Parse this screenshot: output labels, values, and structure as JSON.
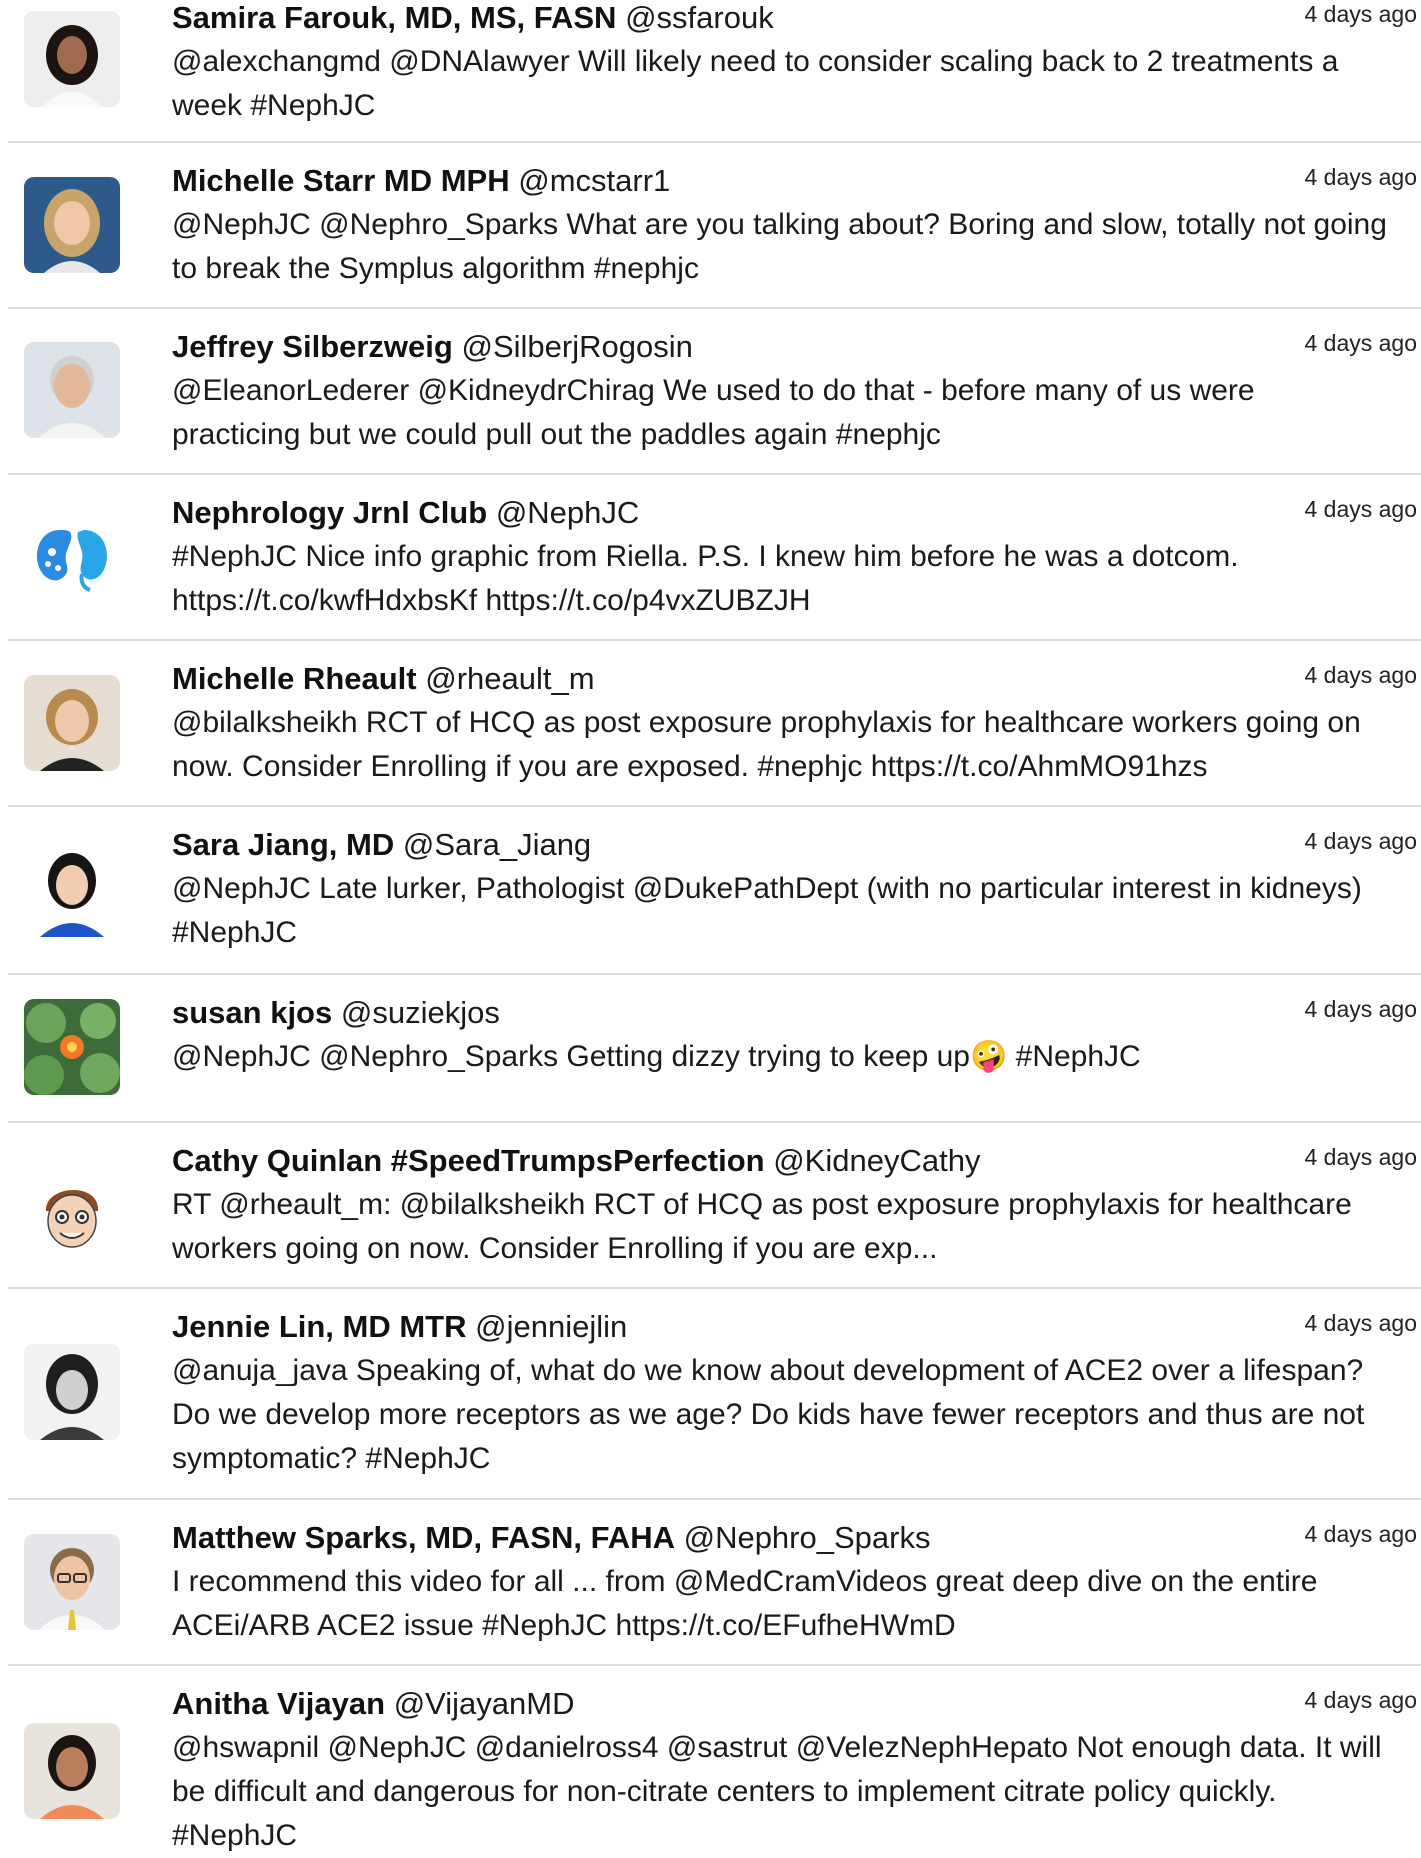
{
  "tweets": [
    {
      "name": "Samira Farouk, MD, MS, FASN",
      "handle": "@ssfarouk",
      "time": "4 days ago",
      "avatar": "woman-dark-hair-avatar",
      "lines": [
        "@alexchangmd @DNAlawyer Will likely need to consider scaling back to 2 treatments a",
        "week #NephJC"
      ]
    },
    {
      "name": "Michelle Starr MD MPH",
      "handle": "@mcstarr1",
      "time": "4 days ago",
      "avatar": "woman-blonde-avatar",
      "lines": [
        "@NephJC @Nephro_Sparks What are you talking about? Boring and slow, totally not going",
        "to break the Symplus algorithm #nephjc"
      ]
    },
    {
      "name": "Jeffrey Silberzweig",
      "handle": "@SilberjRogosin",
      "time": "4 days ago",
      "avatar": "man-grey-hair-avatar",
      "lines": [
        "@EleanorLederer @KidneydrChirag We used to do that - before many of us were",
        "practicing but we could pull out the paddles again #nephjc"
      ]
    },
    {
      "name": "Nephrology Jrnl Club",
      "handle": "@NephJC",
      "time": "4 days ago",
      "avatar": "kidney-logo-avatar",
      "lines": [
        "#NephJC Nice info graphic from Riella. P.S. I knew him before he was a dotcom.",
        "https://t.co/kwfHdxbsKf https://t.co/p4vxZUBZJH"
      ]
    },
    {
      "name": "Michelle Rheault",
      "handle": "@rheault_m",
      "time": "4 days ago",
      "avatar": "woman-short-hair-avatar",
      "lines": [
        "@bilalksheikh RCT of HCQ as post exposure prophylaxis for healthcare workers going on",
        "now. Consider Enrolling if you are exposed. #nephjc https://t.co/AhmMO91hzs"
      ]
    },
    {
      "name": "Sara Jiang, MD",
      "handle": "@Sara_Jiang",
      "time": "4 days ago",
      "avatar": "woman-blue-top-avatar",
      "lines": [
        "@NephJC Late lurker, Pathologist @DukePathDept (with no particular interest in kidneys)",
        "#NephJC"
      ]
    },
    {
      "name": "susan kjos",
      "handle": "@suziekjos",
      "time": "4 days ago",
      "avatar": "lily-pad-flower-avatar",
      "lines": [
        "@NephJC @Nephro_Sparks Getting dizzy trying to keep up🤪  #NephJC"
      ]
    },
    {
      "name": "Cathy Quinlan #SpeedTrumpsPerfection",
      "handle": "@KidneyCathy",
      "time": "4 days ago",
      "avatar": "cartoon-face-avatar",
      "lines": [
        "RT @rheault_m: @bilalksheikh RCT of HCQ as post exposure prophylaxis for healthcare",
        "workers going on now. Consider Enrolling if you are exp..."
      ]
    },
    {
      "name": "Jennie Lin, MD MTR",
      "handle": "@jenniejlin",
      "time": "4 days ago",
      "avatar": "woman-bw-photo-avatar",
      "lines": [
        "@anuja_java Speaking of, what do we know about development of ACE2 over a lifespan?",
        "Do we develop more receptors as we age? Do kids have fewer receptors and thus are not",
        "symptomatic? #NephJC"
      ]
    },
    {
      "name": "Matthew Sparks, MD, FASN, FAHA",
      "handle": "@Nephro_Sparks",
      "time": "4 days ago",
      "avatar": "man-glasses-avatar",
      "lines": [
        "I recommend this video for all ... from @MedCramVideos great deep dive on the entire",
        "ACEi/ARB ACE2 issue #NephJC https://t.co/EFufheHWmD"
      ]
    },
    {
      "name": "Anitha Vijayan",
      "handle": "@VijayanMD",
      "time": "4 days ago",
      "avatar": "woman-orange-top-avatar",
      "lines": [
        "@hswapnil @NephJC @danielross4 @sastrut @VelezNephHepato Not enough data. It will",
        "be difficult and dangerous for non-citrate centers to implement citrate policy quickly.",
        "#NephJC"
      ]
    }
  ]
}
